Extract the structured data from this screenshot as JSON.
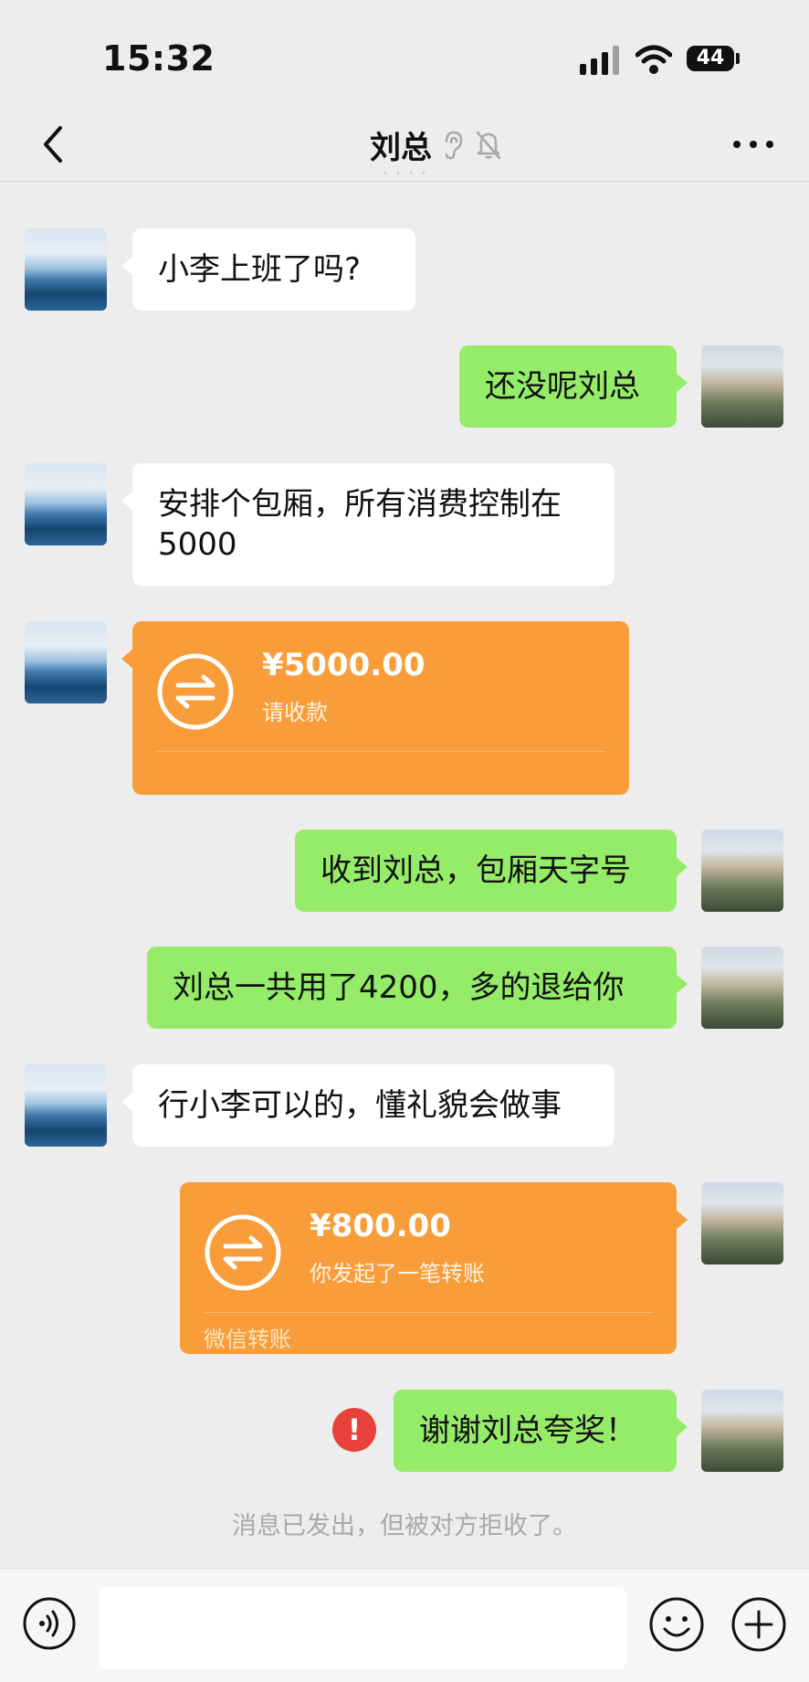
{
  "status_bar": {
    "time": "15:32",
    "battery": "44"
  },
  "header": {
    "contact_name": "刘总",
    "icons": [
      "back-arrow-icon",
      "ear-icon",
      "bell-muted-icon",
      "more-dots-icon"
    ]
  },
  "messages": [
    {
      "side": "left",
      "type": "text",
      "text": "小李上班了吗?"
    },
    {
      "side": "right",
      "type": "text",
      "text": "还没呢刘总"
    },
    {
      "side": "left",
      "type": "text",
      "lines": [
        "安排个包厢，所有消费控制在",
        "5000"
      ]
    },
    {
      "side": "left",
      "type": "transfer",
      "amount": "¥5000.00",
      "note": "请收款",
      "footer": ""
    },
    {
      "side": "right",
      "type": "text",
      "text": "收到刘总，包厢天字号"
    },
    {
      "side": "right",
      "type": "text",
      "text": "刘总一共用了4200，多的退给你"
    },
    {
      "side": "left",
      "type": "text",
      "text": "行小李可以的，懂礼貌会做事"
    },
    {
      "side": "right",
      "type": "transfer",
      "amount": "¥800.00",
      "note": "你发起了一笔转账",
      "footer": "微信转账"
    },
    {
      "side": "right",
      "type": "text",
      "text": "谢谢刘总夸奖！",
      "error": "!"
    }
  ],
  "system_note": "消息已发出，但被对方拒收了。",
  "input_bar": {
    "placeholder": "",
    "icons": [
      "voice-icon",
      "emoji-icon",
      "plus-icon"
    ]
  },
  "colors": {
    "background": "#ededed",
    "my_bubble": "#95ec69",
    "their_bubble": "#ffffff",
    "transfer": "#f89d3a",
    "error": "#e8413c"
  }
}
